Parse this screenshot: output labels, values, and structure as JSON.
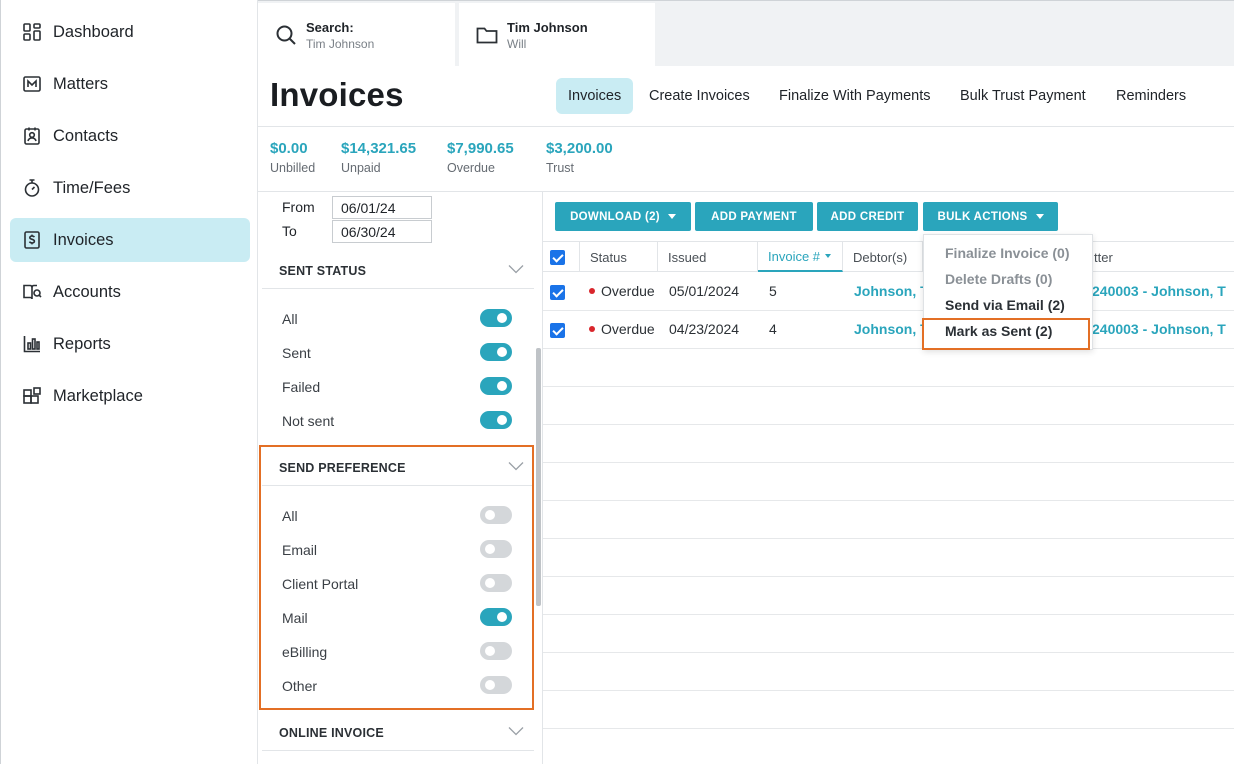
{
  "sidebar": {
    "items": [
      {
        "label": "Dashboard",
        "icon": "dashboard-icon"
      },
      {
        "label": "Matters",
        "icon": "matters-icon"
      },
      {
        "label": "Contacts",
        "icon": "contacts-icon"
      },
      {
        "label": "Time/Fees",
        "icon": "stopwatch-icon"
      },
      {
        "label": "Invoices",
        "icon": "dollar-document-icon",
        "active": true
      },
      {
        "label": "Accounts",
        "icon": "accounts-book-icon"
      },
      {
        "label": "Reports",
        "icon": "bar-chart-icon"
      },
      {
        "label": "Marketplace",
        "icon": "blocks-icon"
      }
    ]
  },
  "topbar": {
    "search": {
      "title": "Search:",
      "subtitle": "Tim Johnson"
    },
    "matter": {
      "title": "Tim Johnson",
      "subtitle": "Will"
    }
  },
  "page": {
    "title": "Invoices",
    "tabs": [
      "Invoices",
      "Create Invoices",
      "Finalize With Payments",
      "Bulk Trust Payment",
      "Reminders"
    ]
  },
  "stats": [
    {
      "value": "$0.00",
      "label": "Unbilled"
    },
    {
      "value": "$14,321.65",
      "label": "Unpaid"
    },
    {
      "value": "$7,990.65",
      "label": "Overdue"
    },
    {
      "value": "$3,200.00",
      "label": "Trust"
    }
  ],
  "filters": {
    "from_label": "From",
    "from_value": "06/01/24",
    "to_label": "To",
    "to_value": "06/30/24",
    "sent_status": {
      "title": "SENT STATUS",
      "options": [
        {
          "label": "All",
          "on": true
        },
        {
          "label": "Sent",
          "on": true
        },
        {
          "label": "Failed",
          "on": true
        },
        {
          "label": "Not sent",
          "on": true
        }
      ]
    },
    "send_preference": {
      "title": "SEND PREFERENCE",
      "options": [
        {
          "label": "All",
          "on": false
        },
        {
          "label": "Email",
          "on": false
        },
        {
          "label": "Client Portal",
          "on": false
        },
        {
          "label": "Mail",
          "on": true
        },
        {
          "label": "eBilling",
          "on": false
        },
        {
          "label": "Other",
          "on": false
        }
      ]
    },
    "online_invoice": {
      "title": "ONLINE INVOICE"
    }
  },
  "actions": {
    "download": "DOWNLOAD (2)",
    "add_payment": "ADD PAYMENT",
    "add_credit": "ADD CREDIT",
    "bulk_actions": "BULK ACTIONS"
  },
  "bulk_menu": [
    {
      "label": "Finalize Invoice (0)",
      "enabled": false
    },
    {
      "label": "Delete Drafts (0)",
      "enabled": false
    },
    {
      "label": "Send via Email (2)",
      "enabled": true
    },
    {
      "label": "Mark as Sent (2)",
      "enabled": true,
      "highlighted": true
    }
  ],
  "table": {
    "columns": [
      "Status",
      "Issued",
      "Invoice #",
      "Debtor(s)",
      "tter"
    ],
    "rows": [
      {
        "status": "Overdue",
        "issued": "05/01/2024",
        "invoice": "5",
        "debtor": "Johnson, T",
        "matter": "240003 - Johnson, T"
      },
      {
        "status": "Overdue",
        "issued": "04/23/2024",
        "invoice": "4",
        "debtor": "Johnson, T",
        "matter": "240003 - Johnson, T"
      }
    ]
  },
  "colors": {
    "accent": "#2aa5bc",
    "active_bg": "#c9ecf3",
    "highlight": "#e36f25",
    "overdue_dot": "#d9262c"
  }
}
